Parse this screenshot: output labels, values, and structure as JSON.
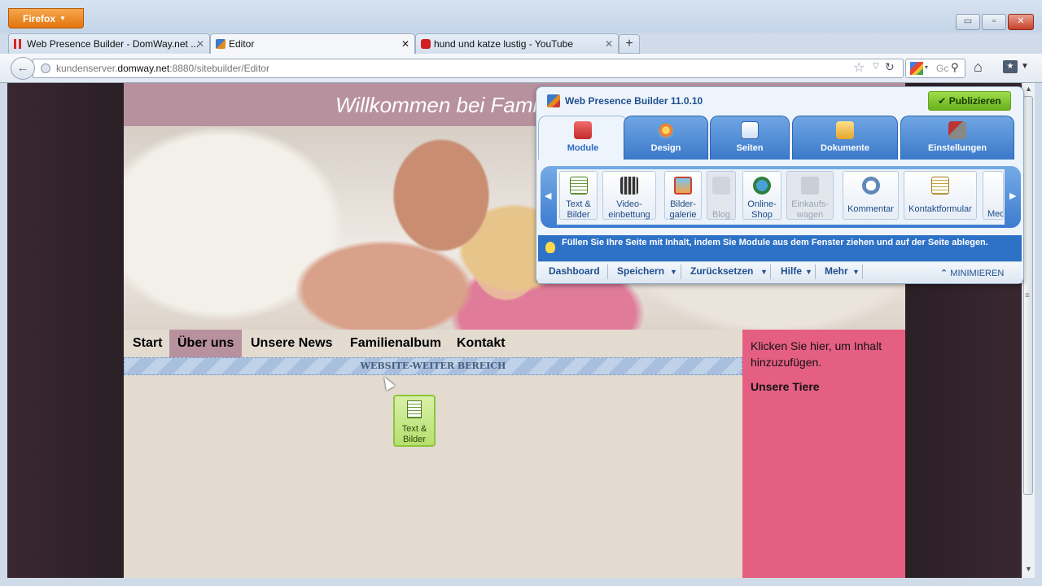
{
  "browser": {
    "menu_button": "Firefox",
    "window_controls": {
      "minimize": "▭",
      "restore": "▫",
      "close": "✕"
    },
    "tabs": [
      {
        "label": "Web Presence Builder - DomWay.net ...",
        "close": "✕"
      },
      {
        "label": "Editor",
        "close": "✕"
      },
      {
        "label": "hund und katze lustig - YouTube",
        "close": "✕"
      }
    ],
    "new_tab": "+",
    "url": {
      "prefix": "kundenserver.",
      "domain": "domway.net",
      "rest": ":8880/sitebuilder/Editor"
    },
    "search_placeholder": "Gc",
    "icons": {
      "back": "back-arrow-icon",
      "star": "star-icon",
      "reload": "reload-icon",
      "home": "home-icon",
      "search": "magnifier-icon"
    }
  },
  "site": {
    "header_title": "Willkommen bei Fami",
    "nav": [
      "Start",
      "Über uns",
      "Unsere News",
      "Familienalbum",
      "Kontakt"
    ],
    "active_nav": "Über uns",
    "wide_area_label": "WEBSITE-WEITER BEREICH",
    "sidebar_text": "Klicken Sie hier, um Inhalt hinzuzufügen.",
    "sidebar_heading": "Unsere Tiere",
    "drag_module_label": "Text & Bilder"
  },
  "builder": {
    "title": "Web Presence Builder 11.0.10",
    "publish": "Publizieren",
    "tabs": [
      "Module",
      "Design",
      "Seiten",
      "Dokumente",
      "Einstellungen"
    ],
    "active_tab": "Module",
    "modules": [
      {
        "line1": "Text &",
        "line2": "Bilder",
        "enabled": true
      },
      {
        "line1": "Video-",
        "line2": "einbettung",
        "enabled": true
      },
      {
        "line1": "Bilder-",
        "line2": "galerie",
        "enabled": true
      },
      {
        "line1": "",
        "line2": "Blog",
        "enabled": false
      },
      {
        "line1": "Online-",
        "line2": "Shop",
        "enabled": true
      },
      {
        "line1": "Einkaufs-",
        "line2": "wagen",
        "enabled": false
      },
      {
        "line1": "",
        "line2": "Kommentar",
        "enabled": true
      },
      {
        "line1": "",
        "line2": "Kontaktformular",
        "enabled": true
      },
      {
        "line1": "",
        "line2": "Med",
        "enabled": true
      }
    ],
    "hint": "Füllen Sie Ihre Seite mit Inhalt, indem Sie Module aus dem Fenster ziehen und auf der Seite ablegen.",
    "footer": [
      "Dashboard",
      "Speichern",
      "Zurücksetzen",
      "Hilfe",
      "Mehr"
    ],
    "minimize": "MINIMIEREN",
    "colors": {
      "accent": "#3b79c9",
      "publish": "#7cc32c",
      "sidebar": "#e55f82",
      "header": "#b8919f"
    }
  }
}
